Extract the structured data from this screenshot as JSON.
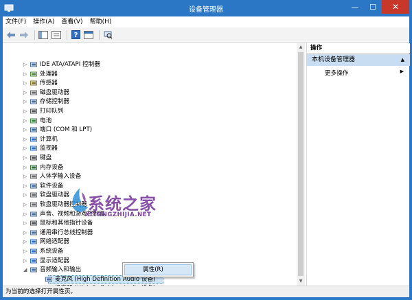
{
  "window": {
    "title": "设备管理器"
  },
  "menubar": [
    {
      "label": "文件(F)"
    },
    {
      "label": "操作(A)"
    },
    {
      "label": "查看(V)"
    },
    {
      "label": "帮助(H)"
    }
  ],
  "tree": [
    {
      "label": "IDE ATA/ATAPI 控制器",
      "icon": "ide-controller-icon"
    },
    {
      "label": "处理器",
      "icon": "processor-icon"
    },
    {
      "label": "传感器",
      "icon": "sensor-icon"
    },
    {
      "label": "磁盘驱动器",
      "icon": "disk-drive-icon"
    },
    {
      "label": "存储控制器",
      "icon": "storage-controller-icon"
    },
    {
      "label": "打印队列",
      "icon": "printer-icon"
    },
    {
      "label": "电池",
      "icon": "battery-icon"
    },
    {
      "label": "端口 (COM 和 LPT)",
      "icon": "port-icon"
    },
    {
      "label": "计算机",
      "icon": "computer-icon"
    },
    {
      "label": "监视器",
      "icon": "monitor-icon"
    },
    {
      "label": "键盘",
      "icon": "keyboard-icon"
    },
    {
      "label": "内存设备",
      "icon": "memory-icon"
    },
    {
      "label": "人体学输入设备",
      "icon": "hid-icon"
    },
    {
      "label": "软件设备",
      "icon": "software-device-icon"
    },
    {
      "label": "软盘驱动器",
      "icon": "floppy-icon"
    },
    {
      "label": "软盘驱动器控制器",
      "icon": "floppy-controller-icon"
    },
    {
      "label": "声音、视频和游戏控制器",
      "icon": "sound-icon"
    },
    {
      "label": "鼠标和其他指针设备",
      "icon": "mouse-icon"
    },
    {
      "label": "通用串行总线控制器",
      "icon": "usb-icon"
    },
    {
      "label": "网络适配器",
      "icon": "network-adapter-icon"
    },
    {
      "label": "系统设备",
      "icon": "system-device-icon"
    },
    {
      "label": "显示适配器",
      "icon": "display-adapter-icon"
    },
    {
      "label": "音频输入和输出",
      "icon": "audio-io-icon",
      "expanded": true
    },
    {
      "label": "麦克风 (High Definition Audio 设备)",
      "icon": "microphone-icon",
      "child": true,
      "selected": true
    },
    {
      "label": "扬声器 (High Definition Audio 设备)",
      "icon": "speaker-icon",
      "child": true
    }
  ],
  "actions": {
    "header": "操作",
    "section": "本机设备管理器",
    "more": "更多操作"
  },
  "context_menu": {
    "item": "属性(R)"
  },
  "status": "为当前的选择打开属性页。",
  "watermark": {
    "title": "系统之家",
    "sub": "XITONGZHIJIA.NET"
  },
  "colors": {
    "titlebar": "#2b77c5",
    "close": "#c7372a",
    "selection": "#cce4f7",
    "action_section": "#c8ddf2"
  }
}
